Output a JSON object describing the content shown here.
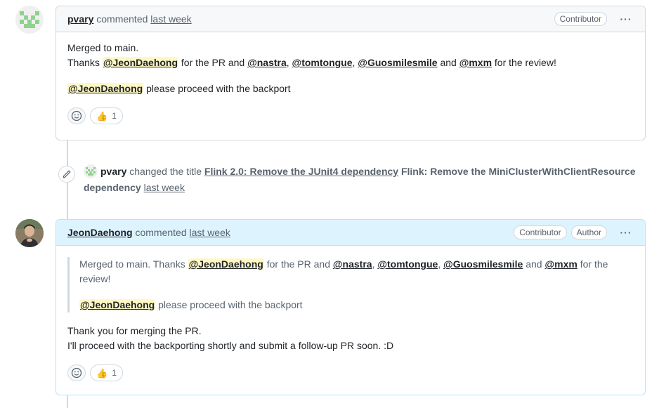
{
  "comment1": {
    "author": "pvary",
    "verb": "commented",
    "time": "last week",
    "badges": [
      "Contributor"
    ],
    "line1": "Merged to main.",
    "thanks_prefix": "Thanks",
    "mention_main": "@JeonDaehong",
    "for_pr": "for the PR and",
    "mentions": [
      "@nastra",
      "@tomtongue",
      "@Guosmilesmile",
      "@mxm"
    ],
    "and_word": "and",
    "for_review": "for the review!",
    "line3_rest": "please proceed with the backport",
    "reaction_count": "1"
  },
  "event": {
    "actor": "pvary",
    "action": "changed the title",
    "old_title": "Flink 2.0: Remove the JUnit4 dependency",
    "new_title": "Flink: Remove the MiniClusterWithClientResource dependency",
    "time": "last week"
  },
  "comment2": {
    "author": "JeonDaehong",
    "verb": "commented",
    "time": "last week",
    "badges": [
      "Contributor",
      "Author"
    ],
    "quote_line1": "Merged to main. Thanks",
    "quote_mention": "@JeonDaehong",
    "quote_for_pr": "for the PR and",
    "quote_mentions": [
      "@nastra",
      "@tomtongue",
      "@Guosmilesmile",
      "@mxm"
    ],
    "quote_and": "and",
    "quote_for_review": "for the review!",
    "quote_line2_rest": "please proceed with the backport",
    "reply_line1": "Thank you for merging the PR.",
    "reply_line2": "I'll proceed with the backporting shortly and submit a follow-up PR soon. :D",
    "reaction_count": "1"
  },
  "icons": {
    "kebab": "kebab-horizontal-icon",
    "add_reaction": "smiley-icon",
    "thumbs_up": "thumbs-up-emoji",
    "edit": "pencil-icon"
  },
  "colors": {
    "mention_highlight": "#fff8c5",
    "author_header": "#ddf4ff",
    "border": "#d1d9e0"
  }
}
